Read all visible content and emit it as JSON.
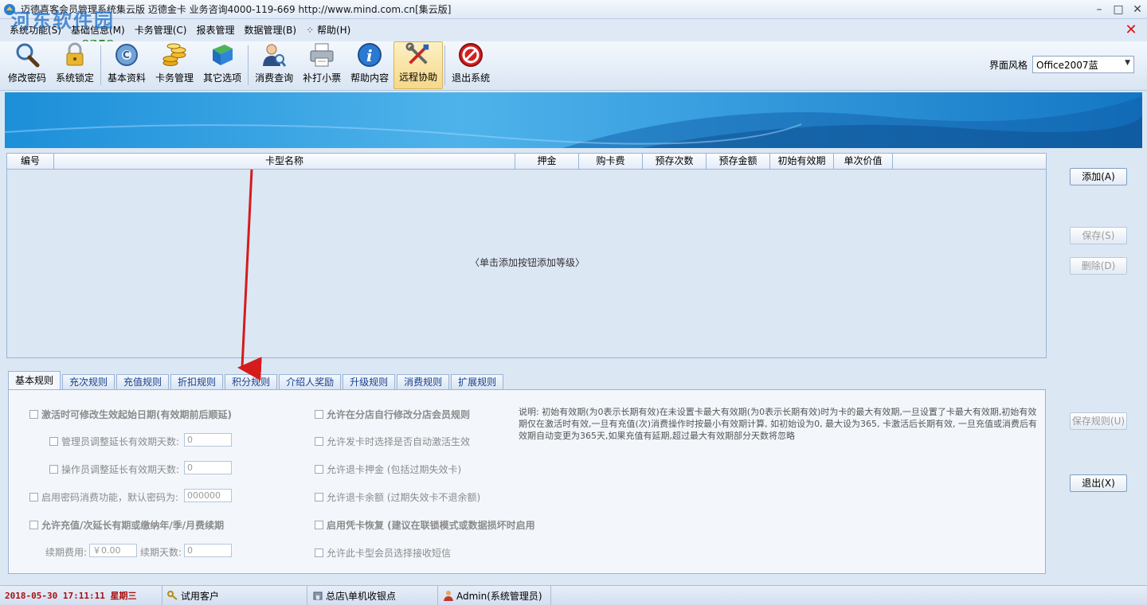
{
  "window": {
    "title": "迈德喜客会员管理系统集云版  迈德金卡  业务咨询4000-119-669  http://www.mind.com.cn[集云版]"
  },
  "watermark": {
    "text": "河东软件园",
    "url": "www.pc0359.cn"
  },
  "menu": {
    "items": [
      "系统功能(S)",
      "基础信息(M)",
      "卡务管理(C)",
      "报表管理",
      "数据管理(B)",
      "帮助(H)"
    ]
  },
  "toolbar": {
    "buttons": [
      {
        "label": "修改密码",
        "icon": "magnifier-icon"
      },
      {
        "label": "系统锁定",
        "icon": "lock-icon"
      },
      {
        "label": "基本资料",
        "icon": "settings-disc-icon"
      },
      {
        "label": "卡务管理",
        "icon": "coins-icon"
      },
      {
        "label": "其它选项",
        "icon": "book-icon"
      },
      {
        "label": "消费查询",
        "icon": "user-search-icon"
      },
      {
        "label": "补打小票",
        "icon": "printer-icon"
      },
      {
        "label": "帮助内容",
        "icon": "info-icon"
      },
      {
        "label": "远程协助",
        "icon": "tools-icon"
      },
      {
        "label": "退出系统",
        "icon": "stop-icon"
      }
    ],
    "style_label": "界面风格",
    "style_value": "Office2007蓝"
  },
  "grid": {
    "columns": [
      "编号",
      "卡型名称",
      "押金",
      "购卡费",
      "预存次数",
      "预存金额",
      "初始有效期",
      "单次价值"
    ],
    "empty_text": "〈单击添加按钮添加等级〉"
  },
  "side_buttons": {
    "add": "添加(A)",
    "save": "保存(S)",
    "delete": "删除(D)",
    "save_rules": "保存规则(U)",
    "exit": "退出(X)"
  },
  "tabs": [
    "基本规则",
    "充次规则",
    "充值规则",
    "折扣规则",
    "积分规则",
    "介绍人奖励",
    "升级规则",
    "消费规则",
    "扩展规则"
  ],
  "rules": {
    "activation": "激活时可修改生效起始日期(有效期前后顺延)",
    "admin_extend": "管理员调整延长有效期天数:",
    "admin_extend_value": "0",
    "operator_extend": "操作员调整延长有效期天数:",
    "operator_extend_value": "0",
    "password_consume": "启用密码消费功能，默认密码为:",
    "password_value": "000000",
    "renew": "允许充值/次延长有期或缴纳年/季/月费续期",
    "renew_fee_label": "续期费用:",
    "renew_fee_value": "￥0.00",
    "renew_days_label": "续期天数:",
    "renew_days_value": "0",
    "branch_modify": "允许在分店自行修改分店会员规则",
    "auto_activate": "允许发卡时选择是否自动激活生效",
    "refund_deposit": "允许退卡押金 (包括过期失效卡)",
    "refund_balance": "允许退卡余额 (过期失效卡不退余额)",
    "card_restore": "启用凭卡恢复 (建议在联锁模式或数据损坏时启用",
    "sms": "允许此卡型会员选择接收短信",
    "note": "说明: 初始有效期(为0表示长期有效)在未设置卡最大有效期(为0表示长期有效)时为卡的最大有效期,一旦设置了卡最大有效期,初始有效期仅在激活时有效,一旦有充值(次)消费操作时按最小有效期计算, 如初始设为0, 最大设为365, 卡激活后长期有效, 一旦充值或消费后有效期自动变更为365天,如果充值有延期,超过最大有效期部分天数将忽略"
  },
  "status": {
    "datetime": "2018-05-30  17:11:11  星期三",
    "customer": "试用客户",
    "store": "总店\\单机收银点",
    "user": "Admin(系统管理员)"
  }
}
